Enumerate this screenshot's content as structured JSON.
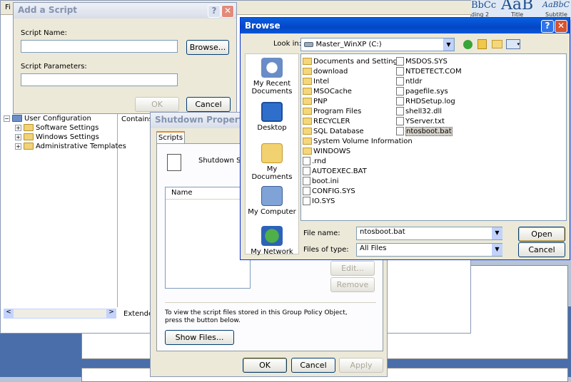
{
  "background": {
    "word_styles": [
      {
        "sample": "BbCc",
        "label": "ding 2"
      },
      {
        "sample": "AaB",
        "label": "Title"
      },
      {
        "sample": "AaBbC",
        "label": "Subtitle"
      }
    ]
  },
  "gpe": {
    "menu_first": "Fi",
    "contains_text": "Contains c",
    "tree": [
      {
        "label": "User Configuration",
        "level": 0
      },
      {
        "label": "Software Settings",
        "level": 1
      },
      {
        "label": "Windows Settings",
        "level": 1
      },
      {
        "label": "Administrative Templates",
        "level": 1
      }
    ],
    "tab_extended": "Extended"
  },
  "add_script": {
    "title": "Add a Script",
    "script_name_label": "Script Name:",
    "script_name_value": "",
    "browse_button": "Browse...",
    "params_label": "Script Parameters:",
    "params_value": "",
    "ok_button": "OK",
    "cancel_button": "Cancel"
  },
  "shutdown": {
    "title": "Shutdown Properties",
    "tab": "Scripts",
    "heading": "Shutdown Scripts",
    "column_name": "Name",
    "edit_button": "Edit...",
    "remove_button": "Remove",
    "info_text": "To view the script files stored in this Group Policy Object, press the button below.",
    "show_files_button": "Show Files...",
    "ok_button": "OK",
    "cancel_button": "Cancel",
    "apply_button": "Apply"
  },
  "browse": {
    "title": "Browse",
    "look_in_label": "Look in:",
    "look_in_value": "Master_WinXP (C:)",
    "places": [
      {
        "label": "My Recent Documents",
        "icon": "recent-docs-icon"
      },
      {
        "label": "Desktop",
        "icon": "desktop-icon"
      },
      {
        "label": "My Documents",
        "icon": "my-documents-icon"
      },
      {
        "label": "My Computer",
        "icon": "my-computer-icon"
      },
      {
        "label": "My Network",
        "icon": "my-network-icon"
      }
    ],
    "files_col1": [
      {
        "name": "Documents and Settings",
        "type": "folder"
      },
      {
        "name": "download",
        "type": "folder"
      },
      {
        "name": "Intel",
        "type": "folder"
      },
      {
        "name": "MSOCache",
        "type": "folder"
      },
      {
        "name": "PNP",
        "type": "folder"
      },
      {
        "name": "Program Files",
        "type": "folder"
      },
      {
        "name": "RECYCLER",
        "type": "folder"
      },
      {
        "name": "SQL Database",
        "type": "folder"
      },
      {
        "name": "System Volume Information",
        "type": "folder"
      },
      {
        "name": "WINDOWS",
        "type": "folder"
      },
      {
        "name": ".rnd",
        "type": "file"
      },
      {
        "name": "AUTOEXEC.BAT",
        "type": "file"
      },
      {
        "name": "boot.ini",
        "type": "file"
      },
      {
        "name": "CONFIG.SYS",
        "type": "file"
      },
      {
        "name": "IO.SYS",
        "type": "file"
      }
    ],
    "files_col2": [
      {
        "name": "MSDOS.SYS",
        "type": "file"
      },
      {
        "name": "NTDETECT.COM",
        "type": "file"
      },
      {
        "name": "ntldr",
        "type": "file"
      },
      {
        "name": "pagefile.sys",
        "type": "file"
      },
      {
        "name": "RHDSetup.log",
        "type": "file"
      },
      {
        "name": "shell32.dll",
        "type": "file"
      },
      {
        "name": "YServer.txt",
        "type": "file"
      },
      {
        "name": "ntosboot.bat",
        "type": "file",
        "selected": true
      }
    ],
    "file_name_label": "File name:",
    "file_name_value": "ntosboot.bat",
    "file_type_label": "Files of type:",
    "file_type_value": "All Files",
    "open_button": "Open",
    "cancel_button": "Cancel"
  }
}
